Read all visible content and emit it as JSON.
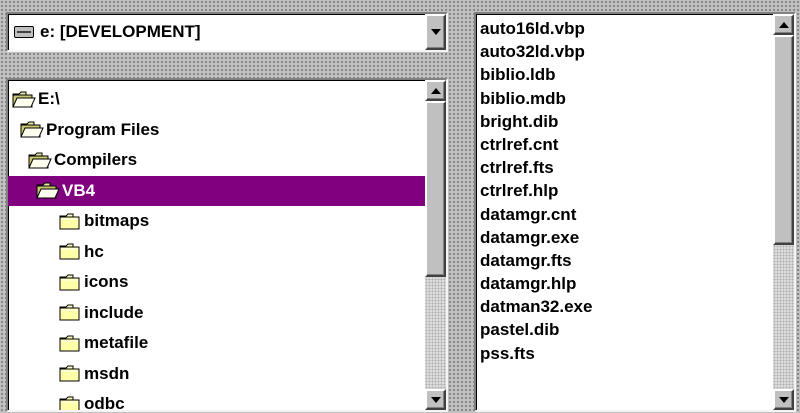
{
  "drive_combo": {
    "value": "e: [DEVELOPMENT]",
    "icon": "hard-drive-icon"
  },
  "dir_list": {
    "items": [
      {
        "label": "E:\\",
        "icon": "open-folder-icon",
        "level": 0,
        "open": true,
        "selected": false
      },
      {
        "label": "Program Files",
        "icon": "open-folder-icon",
        "level": 1,
        "open": true,
        "selected": false
      },
      {
        "label": "Compilers",
        "icon": "open-folder-icon",
        "level": 2,
        "open": true,
        "selected": false
      },
      {
        "label": "VB4",
        "icon": "open-folder-icon",
        "level": 3,
        "open": true,
        "selected": true
      },
      {
        "label": "bitmaps",
        "icon": "closed-folder-icon",
        "level": 4,
        "open": false,
        "selected": false
      },
      {
        "label": "hc",
        "icon": "closed-folder-icon",
        "level": 4,
        "open": false,
        "selected": false
      },
      {
        "label": "icons",
        "icon": "closed-folder-icon",
        "level": 4,
        "open": false,
        "selected": false
      },
      {
        "label": "include",
        "icon": "closed-folder-icon",
        "level": 4,
        "open": false,
        "selected": false
      },
      {
        "label": "metafile",
        "icon": "closed-folder-icon",
        "level": 4,
        "open": false,
        "selected": false
      },
      {
        "label": "msdn",
        "icon": "closed-folder-icon",
        "level": 4,
        "open": false,
        "selected": false
      },
      {
        "label": "odbc",
        "icon": "closed-folder-icon",
        "level": 4,
        "open": false,
        "selected": false
      }
    ],
    "scroll_position": 0.0
  },
  "file_list": {
    "items": [
      "auto16ld.vbp",
      "auto32ld.vbp",
      "biblio.ldb",
      "biblio.mdb",
      "bright.dib",
      "ctrlref.cnt",
      "ctrlref.fts",
      "ctrlref.hlp",
      "datamgr.cnt",
      "datamgr.exe",
      "datamgr.fts",
      "datamgr.hlp",
      "datman32.exe",
      "pastel.dib",
      "pss.fts"
    ],
    "scroll_position": 0.0
  },
  "colors": {
    "selection": "#800080",
    "selection_text": "#ffffff",
    "face": "#c0c0c0"
  }
}
